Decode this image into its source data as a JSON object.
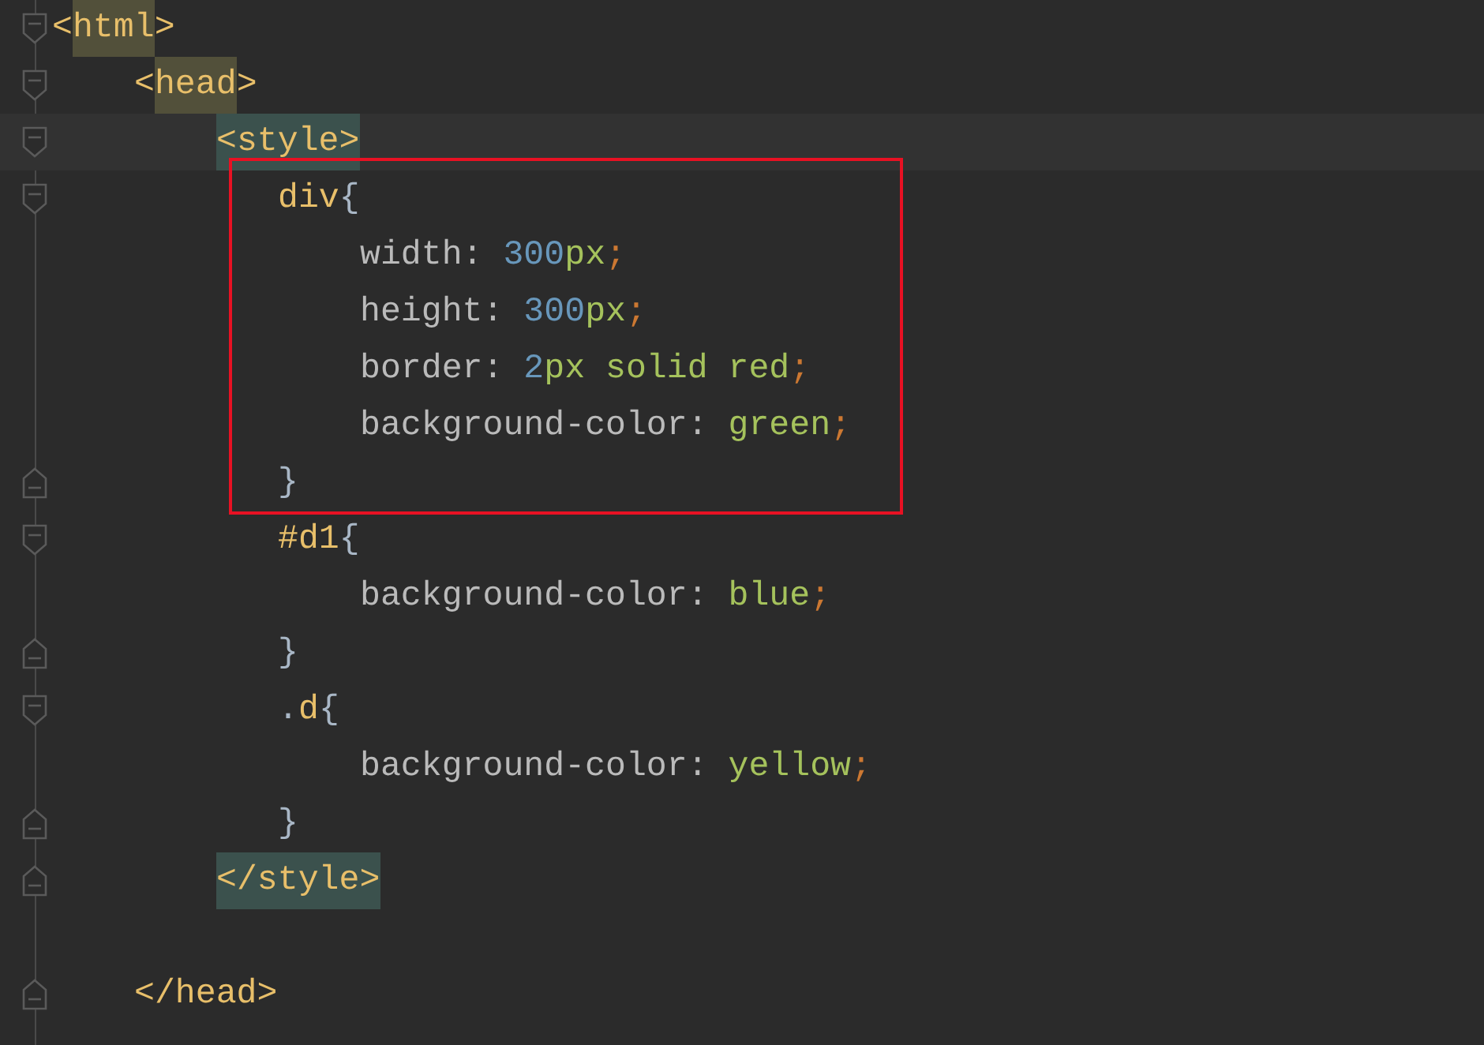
{
  "editor": {
    "lines": [
      {
        "tokens": [
          {
            "text": "<",
            "kind": "tag"
          },
          {
            "text": "html",
            "kind": "tag",
            "matched": true
          },
          {
            "text": ">",
            "kind": "tag"
          }
        ],
        "children": [
          {
            "tokens": [
              {
                "text": "<",
                "kind": "tag"
              },
              {
                "text": "head",
                "kind": "tag",
                "matched": true
              },
              {
                "text": ">",
                "kind": "tag"
              }
            ],
            "children": [
              {
                "current": true,
                "tokens": [
                  {
                    "text": "<style>",
                    "kind": "tag",
                    "selected": true
                  }
                ],
                "children": [
                  {
                    "kind": "rule",
                    "framed": true,
                    "tokens": [
                      {
                        "text": "div",
                        "kind": "tag"
                      },
                      {
                        "text": "{",
                        "kind": "brace"
                      }
                    ],
                    "children": [
                      {
                        "tokens": [
                          {
                            "text": "width:",
                            "kind": "prop"
                          },
                          {
                            "text": "300",
                            "kind": "number"
                          },
                          {
                            "text": "px",
                            "kind": "value"
                          },
                          {
                            "text": ";",
                            "kind": "semi"
                          }
                        ]
                      },
                      {
                        "tokens": [
                          {
                            "text": "height:",
                            "kind": "prop"
                          },
                          {
                            "text": "300",
                            "kind": "number"
                          },
                          {
                            "text": "px",
                            "kind": "value"
                          },
                          {
                            "text": ";",
                            "kind": "semi"
                          }
                        ]
                      },
                      {
                        "tokens": [
                          {
                            "text": "border:",
                            "kind": "prop"
                          },
                          {
                            "text": "2",
                            "kind": "number"
                          },
                          {
                            "text": "px solid red",
                            "kind": "value"
                          },
                          {
                            "text": ";",
                            "kind": "semi"
                          }
                        ]
                      },
                      {
                        "tokens": [
                          {
                            "text": "background-color:",
                            "kind": "prop"
                          },
                          {
                            "text": "green",
                            "kind": "value"
                          },
                          {
                            "text": ";",
                            "kind": "semi"
                          }
                        ]
                      }
                    ],
                    "close": {
                      "tokens": [
                        {
                          "text": "}",
                          "kind": "brace"
                        }
                      ]
                    }
                  },
                  {
                    "kind": "rule",
                    "tokens": [
                      {
                        "text": "#d1",
                        "kind": "tag"
                      },
                      {
                        "text": "{",
                        "kind": "brace"
                      }
                    ],
                    "children": [
                      {
                        "tokens": [
                          {
                            "text": "background-color:",
                            "kind": "prop"
                          },
                          {
                            "text": "blue",
                            "kind": "value"
                          },
                          {
                            "text": ";",
                            "kind": "semi"
                          }
                        ]
                      }
                    ],
                    "close": {
                      "tokens": [
                        {
                          "text": "}",
                          "kind": "brace"
                        }
                      ]
                    }
                  },
                  {
                    "kind": "rule",
                    "tokens": [
                      {
                        "text": ".",
                        "kind": "brace"
                      },
                      {
                        "text": "d",
                        "kind": "tag"
                      },
                      {
                        "text": "{",
                        "kind": "brace"
                      }
                    ],
                    "children": [
                      {
                        "tokens": [
                          {
                            "text": "background-color:",
                            "kind": "prop"
                          },
                          {
                            "text": "yellow",
                            "kind": "value"
                          },
                          {
                            "text": ";",
                            "kind": "semi"
                          }
                        ]
                      }
                    ],
                    "close": {
                      "tokens": [
                        {
                          "text": "}",
                          "kind": "brace"
                        }
                      ]
                    }
                  }
                ],
                "close": {
                  "tokens": [
                    {
                      "text": "</style>",
                      "kind": "tag",
                      "selected": true
                    }
                  ]
                }
              }
            ],
            "close": {
              "blank_before": true,
              "tokens": [
                {
                  "text": "</",
                  "kind": "tag"
                },
                {
                  "text": "head",
                  "kind": "tag"
                },
                {
                  "text": ">",
                  "kind": "tag"
                }
              ]
            }
          }
        ]
      }
    ]
  }
}
